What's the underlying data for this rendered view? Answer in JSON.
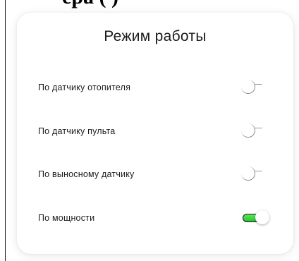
{
  "header_fragment": "epa  ( )",
  "card": {
    "title": "Режим работы",
    "options": [
      {
        "label": "По датчику отопителя",
        "enabled": false
      },
      {
        "label": "По датчику пульта",
        "enabled": false
      },
      {
        "label": "По выносному датчику",
        "enabled": false
      },
      {
        "label": "По мощности",
        "enabled": true
      }
    ]
  },
  "colors": {
    "toggle_on": "#3fd04a",
    "card_background": "#ffffff",
    "text": "#1d1d1d"
  },
  "icons": {
    "toggle_off": "toggle-off-icon",
    "toggle_on": "toggle-on-icon"
  }
}
